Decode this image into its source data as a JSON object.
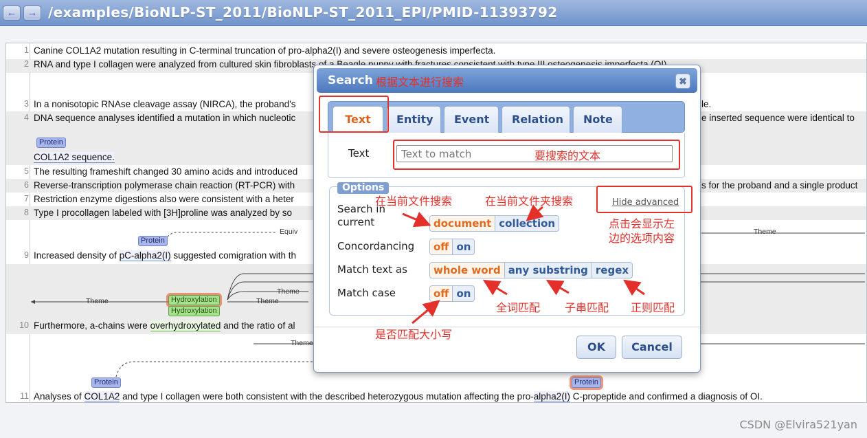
{
  "header": {
    "back_icon": "arrow-left-icon",
    "forward_icon": "arrow-right-icon",
    "back_glyph": "←",
    "forward_glyph": "→",
    "path": "/examples/BioNLP-ST_2011/BioNLP-ST_2011_EPI/PMID-11393792"
  },
  "document": {
    "lines": [
      {
        "n": "1",
        "text": "Canine COL1A2 mutation resulting in C-terminal truncation of pro-alpha2(I) and severe osteogenesis imperfecta."
      },
      {
        "n": "2",
        "text": "RNA and type I collagen were analyzed from cultured skin fibroblasts of a Beagle puppy with fractures consistent with type III osteogenesis imperfecta (OI)."
      },
      {
        "n": "3",
        "text_left": "In a nonisotopic RNAse cleavage assay (NIRCA), the proband's",
        "text_right": "le."
      },
      {
        "n": "4",
        "text_left": "DNA sequence analyses identified a mutation in which nucleotic",
        "text_right": "e inserted sequence were identical to"
      },
      {
        "n": "",
        "text_wrap": "COL1A2 sequence.",
        "ann": "Protein"
      },
      {
        "n": "5",
        "text": "The resulting frameshift changed 30 amino acids and introduced"
      },
      {
        "n": "6",
        "text_left": "Reverse-transcription polymerase chain reaction (RT-PCR) with",
        "text_right": "s for the proband and a single product"
      },
      {
        "n": "7",
        "text": "Restriction enzyme digestions also were consistent with a heter"
      },
      {
        "n": "8",
        "text": "Type I procollagen labeled with [3H]proline was analyzed by so"
      },
      {
        "n": "9",
        "text_pre": "Increased density of ",
        "text_u": "pC-alpha2(I)",
        "text_post": " suggested comigration with th",
        "ann": "Protein",
        "arc_equiv": "Equiv",
        "arc_theme_right": "Theme"
      },
      {
        "n": "10",
        "text_pre": "Furthermore, a-chains were ",
        "text_u": "overhydroxylated",
        "text_post": " and the ratio of al",
        "ann1": "Hydroxylation",
        "ann2": "Hydroxylation",
        "arc_theme_left": "Theme",
        "arc_theme_a": "Theme",
        "arc_theme_b": "Theme",
        "arc_theme_c": "Theme"
      },
      {
        "n": "11",
        "text_pre": "Analyses of ",
        "text_u": "COL1A2",
        "text_mid": " and type I collagen were both consistent with the described heterozygous mutation affecting the pro-",
        "text_u2": "alpha2(I)",
        "text_post": " C-propeptide and confirmed a diagnosis of OI.",
        "ann": "Protein",
        "ann2": "Protein"
      }
    ]
  },
  "dialog": {
    "title": "Search",
    "close_icon": "close-icon",
    "close_glyph": "✖",
    "tabs": [
      "Text",
      "Entity",
      "Event",
      "Relation",
      "Note"
    ],
    "active_tab": "Text",
    "text_label": "Text",
    "text_placeholder": "Text to match",
    "options_legend": "Options",
    "hide_advanced": "Hide advanced",
    "search_in_label": "Search in current",
    "search_in_options": [
      "document",
      "collection"
    ],
    "concordancing_label": "Concordancing",
    "concordancing_options": [
      "off",
      "on"
    ],
    "match_text_label": "Match text as",
    "match_text_options": [
      "whole word",
      "any substring",
      "regex"
    ],
    "match_case_label": "Match case",
    "match_case_options": [
      "off",
      "on"
    ],
    "ok": "OK",
    "cancel": "Cancel"
  },
  "annotations": {
    "title_note": "根据文本进行搜索",
    "input_note": "要搜索的文本",
    "doc_note": "在当前文件搜索",
    "collection_note": "在当前文件夹搜索",
    "advanced_note_1": "点击会显示左",
    "advanced_note_2": "边的选项内容",
    "whole_word_note": "全词匹配",
    "substring_note": "子串匹配",
    "regex_note": "正则匹配",
    "case_note": "是否匹配大小写"
  },
  "watermark": "CSDN @Elvira521yan",
  "colors": {
    "accent": "#df6a20",
    "annotation_red": "#e3302a",
    "header": "#6f93cc"
  }
}
